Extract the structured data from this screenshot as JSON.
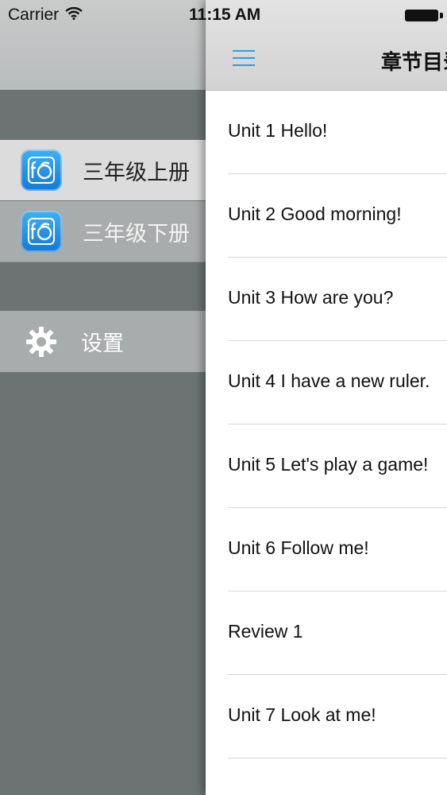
{
  "status_bar": {
    "carrier": "Carrier",
    "time": "11:15 AM"
  },
  "drawer": {
    "items": [
      {
        "label": "三年级上册",
        "icon": "book-app-icon",
        "selected": true
      },
      {
        "label": "三年级下册",
        "icon": "book-app-icon",
        "selected": false
      }
    ],
    "settings": {
      "label": "设置",
      "icon": "gear-icon"
    }
  },
  "nav": {
    "title": "章节目录",
    "menu_icon": "hamburger-menu-icon",
    "accent_color": "#2c9ce8"
  },
  "chapters": [
    "Unit 1 Hello!",
    "Unit 2 Good morning!",
    "Unit 3 How are you?",
    "Unit 4 I have a new ruler.",
    "Unit 5 Let's play a game!",
    "Unit 6 Follow me!",
    "Review 1",
    "Unit 7 Look at me!"
  ]
}
